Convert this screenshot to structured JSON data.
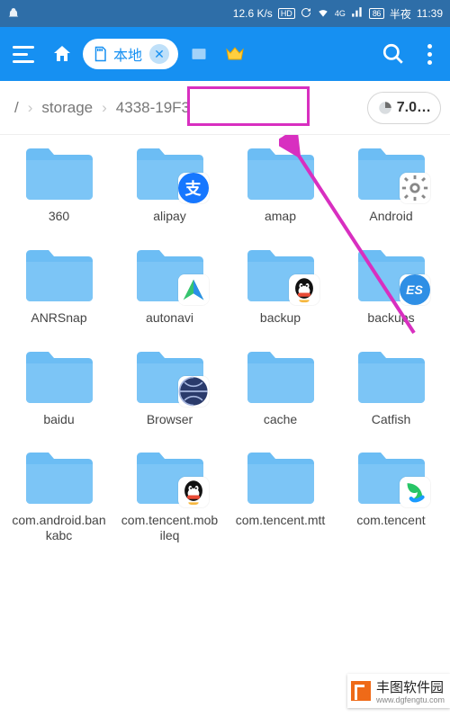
{
  "status": {
    "speed": "12.6 K/s",
    "night_label": "半夜",
    "time": "11:39",
    "battery": "86",
    "signal": "4G"
  },
  "topbar": {
    "location_label": "本地"
  },
  "path": {
    "root": "/",
    "segments": [
      "storage",
      "4338-19F3"
    ],
    "storage_used": "7.0…"
  },
  "folders": [
    {
      "name": "360",
      "badge": null
    },
    {
      "name": "alipay",
      "badge": "alipay"
    },
    {
      "name": "amap",
      "badge": null
    },
    {
      "name": "Android",
      "badge": "gear"
    },
    {
      "name": "ANRSnap",
      "badge": null
    },
    {
      "name": "autonavi",
      "badge": "autonavi"
    },
    {
      "name": "backup",
      "badge": "qq"
    },
    {
      "name": "backups",
      "badge": "es"
    },
    {
      "name": "baidu",
      "badge": null
    },
    {
      "name": "Browser",
      "badge": "browser"
    },
    {
      "name": "cache",
      "badge": null
    },
    {
      "name": "Catfish",
      "badge": null
    },
    {
      "name": "com.android.bankabc",
      "badge": null
    },
    {
      "name": "com.tencent.mobileq",
      "badge": "qq"
    },
    {
      "name": "com.tencent.mtt",
      "badge": null
    },
    {
      "name": "com.tencent",
      "badge": "tencent"
    }
  ],
  "watermark": {
    "title": "丰图软件园",
    "url": "www.dgfengtu.com"
  }
}
